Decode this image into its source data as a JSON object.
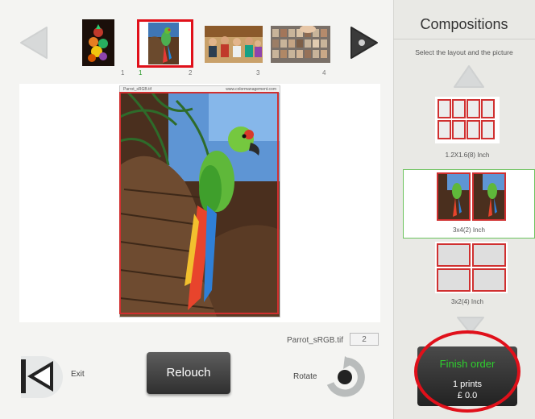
{
  "colors": {
    "selection_red": "#e0101a",
    "layout_red": "#d03030",
    "finish_green": "#2ed02e",
    "selected_layout_border": "#6cc35e"
  },
  "thumbnails": [
    {
      "number": "1",
      "icon": "fruit-photo"
    },
    {
      "number": "2",
      "icon": "parrot-photo",
      "selected_marker": "1"
    },
    {
      "number": "3",
      "icon": "group-photo"
    },
    {
      "number": "4",
      "icon": "collage-photo"
    }
  ],
  "preview": {
    "header_left": "Parrot_sRGB.tif",
    "header_right": "www.colormanagement.com",
    "filename": "Parrot_sRGB.tif",
    "copies": "2"
  },
  "buttons": {
    "exit": "Exit",
    "relouch": "Relouch",
    "rotate": "Rotate"
  },
  "panel": {
    "title": "Compositions",
    "subtitle": "Select the layout and the picture",
    "layouts": [
      {
        "label": "1.2X1.6(8) Inch"
      },
      {
        "label": "3x4(2) Inch"
      },
      {
        "label": "3x2(4) Inch"
      }
    ]
  },
  "finish": {
    "title": "Finish order",
    "prints": "1 prints",
    "price": "£ 0.0"
  }
}
